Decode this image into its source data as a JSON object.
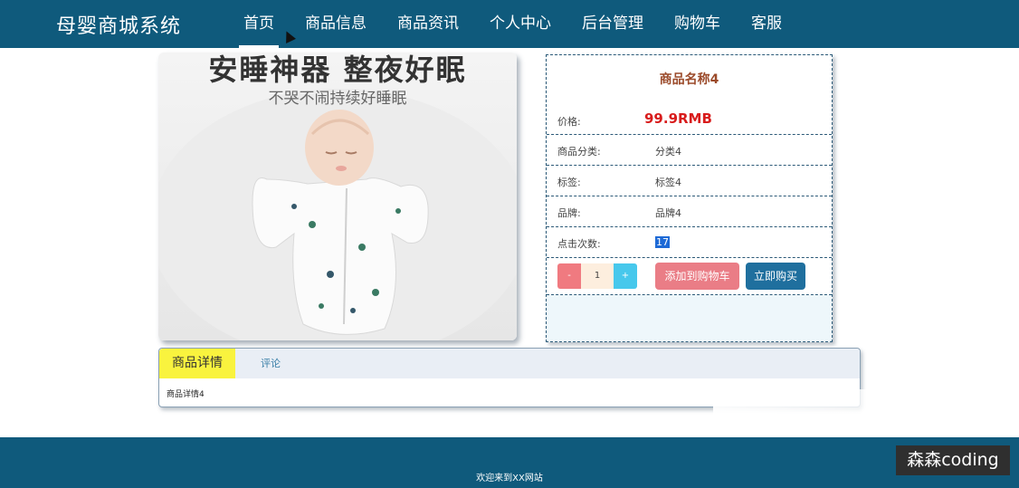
{
  "header": {
    "brand": "母婴商城系统",
    "nav": [
      "首页",
      "商品信息",
      "商品资讯",
      "个人中心",
      "后台管理",
      "购物车",
      "客服"
    ],
    "active_index": 0
  },
  "product_image": {
    "headline": "安睡神器 整夜好眠",
    "subline": "不哭不闹持续好睡眠"
  },
  "product": {
    "name": "商品名称4",
    "price_label": "价格:",
    "price_value": "99.9RMB",
    "category_label": "商品分类:",
    "category_value": "分类4",
    "tag_label": "标签:",
    "tag_value": "标签4",
    "brand_label": "品牌:",
    "brand_value": "品牌4",
    "clicks_label": "点击次数:",
    "clicks_value": "17",
    "qty_minus": "-",
    "qty_value": "1",
    "qty_plus": "+",
    "add_to_cart": "添加到购物车",
    "buy_now": "立即购买"
  },
  "details": {
    "tab_detail": "商品详情",
    "tab_comments": "评论",
    "content": "商品详情4"
  },
  "footer": {
    "text": "欢迎来到XX网站"
  },
  "watermark": "森森coding",
  "colors": {
    "header_bg": "#0f5a7c",
    "price_red": "#d81c1c",
    "cart_pink": "#ea7d86",
    "buy_blue": "#1f6f9e",
    "tab_yellow": "#f9f33e"
  }
}
